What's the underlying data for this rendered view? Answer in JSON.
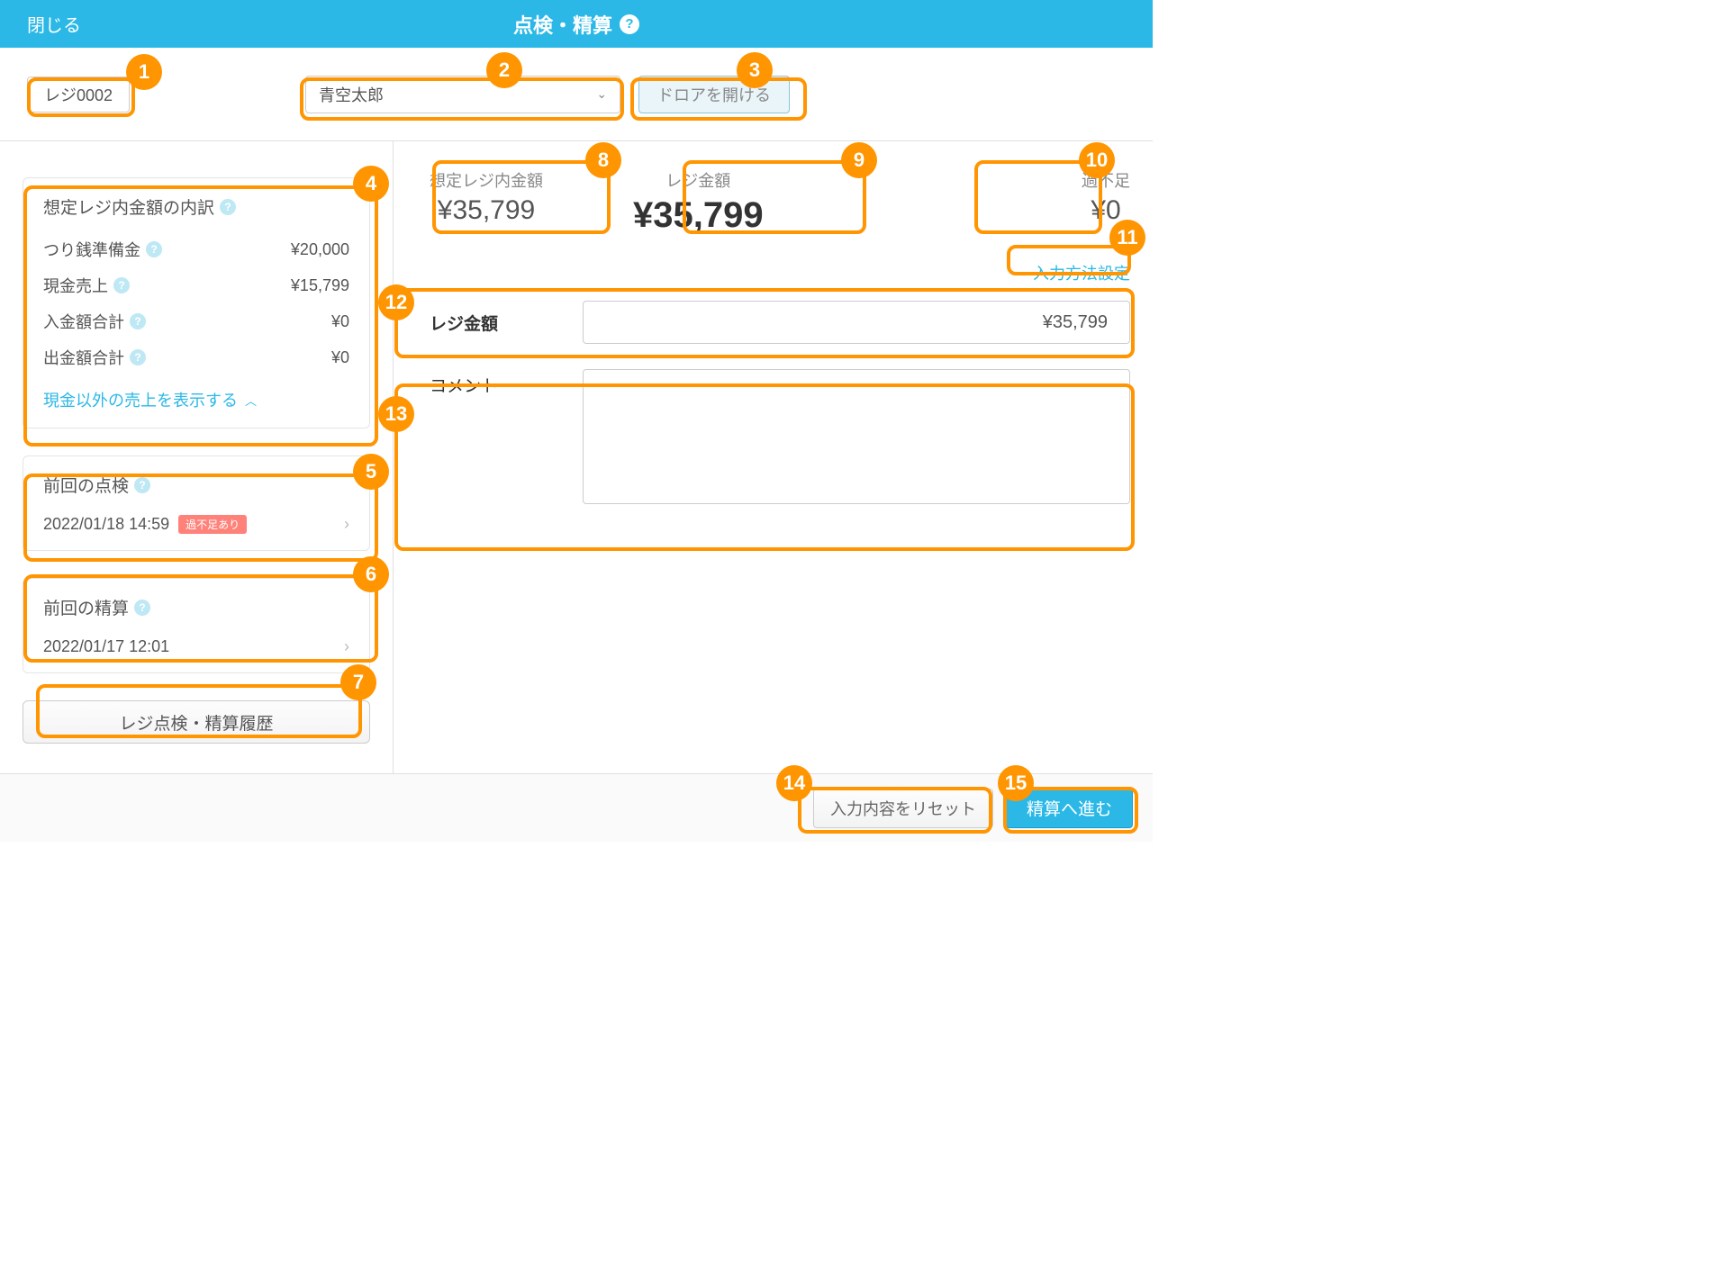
{
  "header": {
    "close": "閉じる",
    "title": "点検・精算"
  },
  "toolbar": {
    "register_label": "レジ0002",
    "staff_name": "青空太郎",
    "drawer_button": "ドロアを開ける"
  },
  "breakdown": {
    "title": "想定レジ内金額の内訳",
    "rows": [
      {
        "label": "つり銭準備金",
        "value": "¥20,000"
      },
      {
        "label": "現金売上",
        "value": "¥15,799"
      },
      {
        "label": "入金額合計",
        "value": "¥0"
      },
      {
        "label": "出金額合計",
        "value": "¥0"
      }
    ],
    "show_other": "現金以外の売上を表示する"
  },
  "prev_check": {
    "title": "前回の点検",
    "datetime": "2022/01/18 14:59",
    "badge": "過不足あり"
  },
  "prev_settle": {
    "title": "前回の精算",
    "datetime": "2022/01/17 12:01"
  },
  "history_button": "レジ点検・精算履歴",
  "summary": {
    "expected": {
      "label": "想定レジ内金額",
      "value": "¥35,799"
    },
    "actual": {
      "label": "レジ金額",
      "value": "¥35,799"
    },
    "diff": {
      "label": "過不足",
      "value": "¥0"
    }
  },
  "input_setting_link": "入力方法設定",
  "amount_field": {
    "label": "レジ金額",
    "value": "¥35,799"
  },
  "comment_field": {
    "label": "コメント",
    "value": ""
  },
  "footer": {
    "reset": "入力内容をリセット",
    "proceed": "精算へ進む"
  },
  "callouts": [
    "1",
    "2",
    "3",
    "4",
    "5",
    "6",
    "7",
    "8",
    "9",
    "10",
    "11",
    "12",
    "13",
    "14",
    "15"
  ]
}
